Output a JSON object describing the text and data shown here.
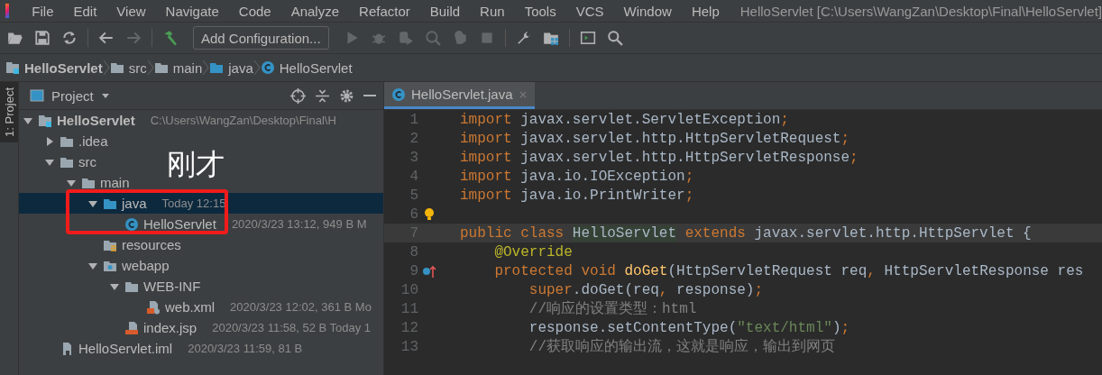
{
  "menu": [
    {
      "label": "File"
    },
    {
      "label": "Edit"
    },
    {
      "label": "View"
    },
    {
      "label": "Navigate"
    },
    {
      "label": "Code"
    },
    {
      "label": "Analyze"
    },
    {
      "label": "Refactor"
    },
    {
      "label": "Build"
    },
    {
      "label": "Run"
    },
    {
      "label": "Tools"
    },
    {
      "label": "VCS"
    },
    {
      "label": "Window"
    },
    {
      "label": "Help"
    }
  ],
  "window": {
    "title": "HelloServlet [C:\\Users\\WangZan\\Desktop\\Final\\HelloServlet]"
  },
  "toolbar": [
    {
      "kind": "open",
      "disabled": false
    },
    {
      "kind": "save",
      "disabled": false
    },
    {
      "kind": "sync",
      "disabled": false
    },
    {
      "kind": "sep"
    },
    {
      "kind": "back",
      "disabled": false
    },
    {
      "kind": "forward",
      "disabled": true
    },
    {
      "kind": "sep"
    },
    {
      "kind": "build",
      "disabled": false
    },
    {
      "kind": "config",
      "label": "Add Configuration..."
    },
    {
      "kind": "run",
      "disabled": true
    },
    {
      "kind": "debug",
      "disabled": true
    },
    {
      "kind": "coverage",
      "disabled": true
    },
    {
      "kind": "profile",
      "disabled": true
    },
    {
      "kind": "attach",
      "disabled": true
    },
    {
      "kind": "stop",
      "disabled": true
    },
    {
      "kind": "sep"
    },
    {
      "kind": "wrench",
      "disabled": false
    },
    {
      "kind": "structure",
      "disabled": false
    },
    {
      "kind": "sep"
    },
    {
      "kind": "terminal",
      "disabled": false
    },
    {
      "kind": "search",
      "disabled": false
    }
  ],
  "breadcrumbs": [
    {
      "kind": "module",
      "label": "HelloServlet"
    },
    {
      "kind": "folder",
      "label": "src"
    },
    {
      "kind": "folder",
      "label": "main"
    },
    {
      "kind": "source",
      "label": "java"
    },
    {
      "kind": "class",
      "label": "HelloServlet"
    }
  ],
  "side_stripe": {
    "label": "1: Project"
  },
  "project_panel": {
    "title": "Project",
    "tree": [
      {
        "name": "HelloServlet",
        "kind": "module",
        "meta": "C:\\Users\\WangZan\\Desktop\\Final\\H",
        "expanded": true,
        "selected": false,
        "children": [
          {
            "name": ".idea",
            "kind": "folder",
            "expanded": false,
            "selected": false
          },
          {
            "name": "src",
            "kind": "folder",
            "expanded": true,
            "selected": false,
            "children": [
              {
                "name": "main",
                "kind": "folder",
                "expanded": true,
                "selected": false,
                "children": [
                  {
                    "name": "java",
                    "kind": "source",
                    "meta": "Today 12:15",
                    "expanded": true,
                    "selected": true,
                    "children": [
                      {
                        "name": "HelloServlet",
                        "kind": "class",
                        "meta": "2020/3/23 13:12, 949 B M",
                        "selected": false
                      }
                    ]
                  },
                  {
                    "name": "resources",
                    "kind": "resources",
                    "selected": false
                  },
                  {
                    "name": "webapp",
                    "kind": "web",
                    "expanded": true,
                    "selected": false,
                    "children": [
                      {
                        "name": "WEB-INF",
                        "kind": "folder",
                        "expanded": true,
                        "selected": false,
                        "children": [
                          {
                            "name": "web.xml",
                            "kind": "xml",
                            "meta": "2020/3/23 12:02, 361 B Mo",
                            "selected": false
                          }
                        ]
                      },
                      {
                        "name": "index.jsp",
                        "kind": "jsp",
                        "meta": "2020/3/23 11:58, 52 B Today 1",
                        "selected": false
                      }
                    ]
                  }
                ]
              }
            ]
          },
          {
            "name": "HelloServlet.iml",
            "kind": "iml",
            "meta": "2020/3/23 11:59, 81 B",
            "selected": false
          }
        ]
      }
    ]
  },
  "annotation": {
    "text": "刚才"
  },
  "editor": {
    "tabs": [
      {
        "label": "HelloServlet.java",
        "selected": true
      }
    ],
    "lines": [
      {
        "number": "1",
        "kind": "code",
        "current": false,
        "tokens": [
          {
            "kind": "kw",
            "text": "import"
          },
          {
            "kind": "plain",
            "text": " javax.servlet.ServletException"
          },
          {
            "kind": "kw",
            "text": ";"
          }
        ]
      },
      {
        "number": "2",
        "kind": "code",
        "current": false,
        "tokens": [
          {
            "kind": "kw",
            "text": "import"
          },
          {
            "kind": "plain",
            "text": " javax.servlet.http.HttpServletRequest"
          },
          {
            "kind": "kw",
            "text": ";"
          }
        ]
      },
      {
        "number": "3",
        "kind": "code",
        "current": false,
        "tokens": [
          {
            "kind": "kw",
            "text": "import"
          },
          {
            "kind": "plain",
            "text": " javax.servlet.http.HttpServletResponse"
          },
          {
            "kind": "kw",
            "text": ";"
          }
        ]
      },
      {
        "number": "4",
        "kind": "code",
        "current": false,
        "tokens": [
          {
            "kind": "kw",
            "text": "import"
          },
          {
            "kind": "plain",
            "text": " java.io.IOException"
          },
          {
            "kind": "kw",
            "text": ";"
          }
        ]
      },
      {
        "number": "5",
        "kind": "code",
        "current": false,
        "tokens": [
          {
            "kind": "kw",
            "text": "import"
          },
          {
            "kind": "plain",
            "text": " java.io.PrintWriter"
          },
          {
            "kind": "kw",
            "text": ";"
          }
        ]
      },
      {
        "number": "6",
        "kind": "hint",
        "current": false
      },
      {
        "number": "7",
        "kind": "code",
        "current": true,
        "tokens": [
          {
            "kind": "kw",
            "text": "public class "
          },
          {
            "kind": "hl",
            "text": "HelloServlet"
          },
          {
            "kind": "kw",
            "text": " extends"
          },
          {
            "kind": "plain",
            "text": " javax.servlet.http.HttpServlet {"
          }
        ]
      },
      {
        "number": "8",
        "kind": "code",
        "current": false,
        "tokens": [
          {
            "kind": "ann",
            "text": "    @Override"
          }
        ]
      },
      {
        "number": "9",
        "kind": "override",
        "current": false,
        "tokens": [
          {
            "kind": "kw",
            "text": "    protected void "
          },
          {
            "kind": "method",
            "text": "doGet"
          },
          {
            "kind": "plain",
            "text": "(HttpServletRequest req"
          },
          {
            "kind": "kw",
            "text": ","
          },
          {
            "kind": "plain",
            "text": " HttpServletResponse res"
          }
        ]
      },
      {
        "number": "10",
        "kind": "code",
        "current": false,
        "tokens": [
          {
            "kind": "kw",
            "text": "        super"
          },
          {
            "kind": "plain",
            "text": ".doGet(req"
          },
          {
            "kind": "kw",
            "text": ","
          },
          {
            "kind": "plain",
            "text": " response)"
          },
          {
            "kind": "kw",
            "text": ";"
          }
        ]
      },
      {
        "number": "11",
        "kind": "code",
        "current": false,
        "tokens": [
          {
            "kind": "comment",
            "text": "        //响应的设置类型：html"
          }
        ]
      },
      {
        "number": "12",
        "kind": "code",
        "current": false,
        "tokens": [
          {
            "kind": "plain",
            "text": "        response.setContentType("
          },
          {
            "kind": "str",
            "text": "\"text/html\""
          },
          {
            "kind": "plain",
            "text": ")"
          },
          {
            "kind": "kw",
            "text": ";"
          }
        ]
      },
      {
        "number": "13",
        "kind": "code",
        "current": false,
        "tokens": [
          {
            "kind": "comment",
            "text": "        //获取响应的输出流，这就是响应，输出到网页"
          }
        ]
      }
    ]
  }
}
